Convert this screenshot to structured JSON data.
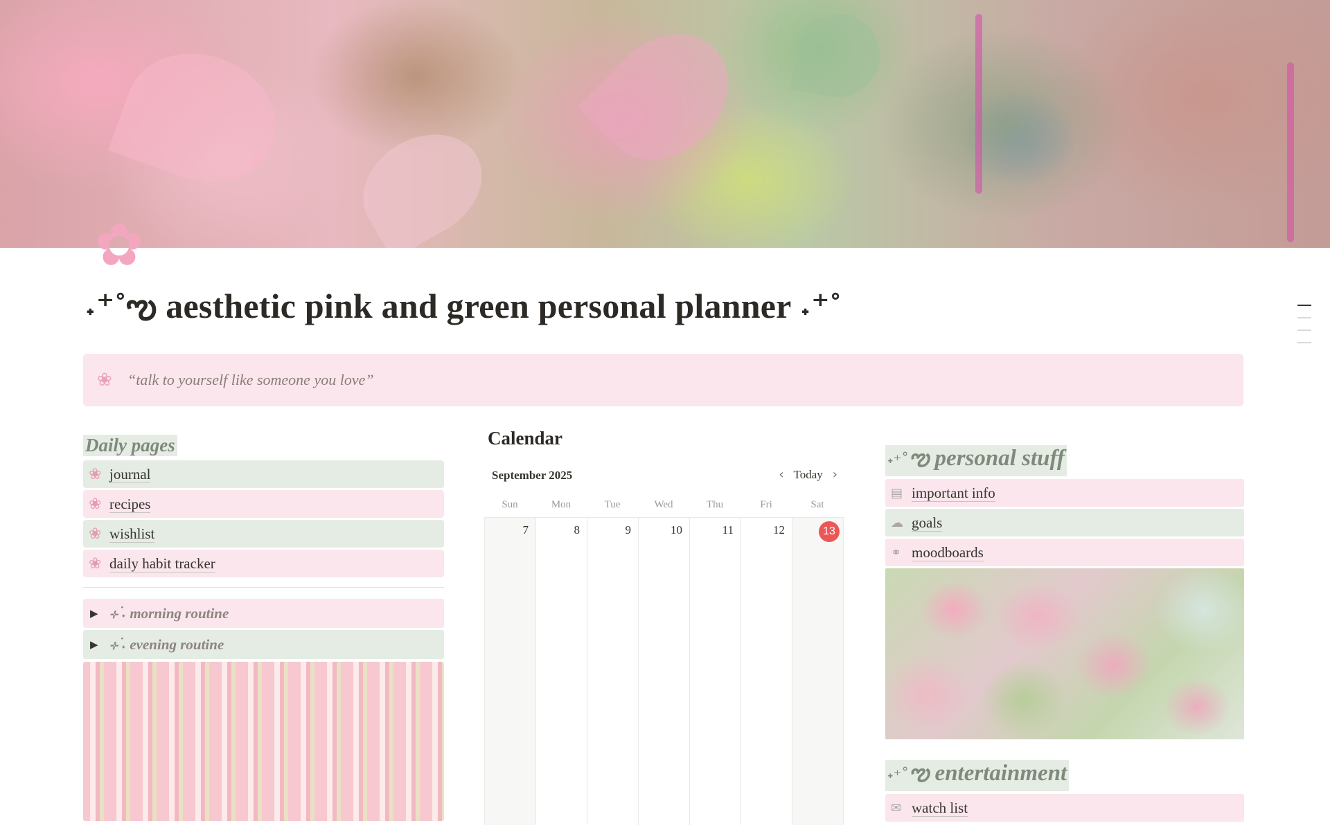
{
  "page": {
    "icon": "cherry-blossom-icon",
    "icon_glyph": "✿",
    "title": "˖⁺˚ఌ aesthetic pink and green personal planner ˖⁺˚"
  },
  "callout": {
    "icon": "cherry-blossom-icon",
    "icon_glyph": "❀",
    "text": "“talk to yourself like someone you love”"
  },
  "daily": {
    "heading": "Daily pages",
    "links": [
      {
        "label": "journal",
        "icon_glyph": "❀"
      },
      {
        "label": "recipes",
        "icon_glyph": "❀"
      },
      {
        "label": "wishlist",
        "icon_glyph": "❀"
      },
      {
        "label": "daily habit tracker",
        "icon_glyph": "❀"
      }
    ],
    "toggles": [
      {
        "label": "⊹ ࣪˖ morning routine",
        "tri": "▶"
      },
      {
        "label": "⊹ ࣪˖ evening routine",
        "tri": "▶"
      }
    ]
  },
  "calendar": {
    "title": "Calendar",
    "month": "September 2025",
    "today_label": "Today",
    "prev": "‹",
    "next": "›",
    "weekdays": [
      "Sun",
      "Mon",
      "Tue",
      "Wed",
      "Thu",
      "Fri",
      "Sat"
    ],
    "days": [
      "7",
      "8",
      "9",
      "10",
      "11",
      "12",
      "13"
    ],
    "today_day": "13"
  },
  "personal": {
    "heading_spark": "˖⁺˚",
    "heading": "ఌ personal stuff",
    "links": [
      {
        "label": "important info",
        "icon_glyph": "▤"
      },
      {
        "label": "goals",
        "icon_glyph": "☁"
      },
      {
        "label": "moodboards",
        "icon_glyph": "⚭"
      }
    ]
  },
  "entertainment": {
    "heading_spark": "˖⁺˚",
    "heading": "ఌ entertainment",
    "links": [
      {
        "label": "watch list",
        "icon_glyph": "✉"
      }
    ]
  },
  "colors": {
    "green_bg": "#e4ece3",
    "pink_bg": "#fae6ec",
    "today_red": "#eb5757"
  }
}
